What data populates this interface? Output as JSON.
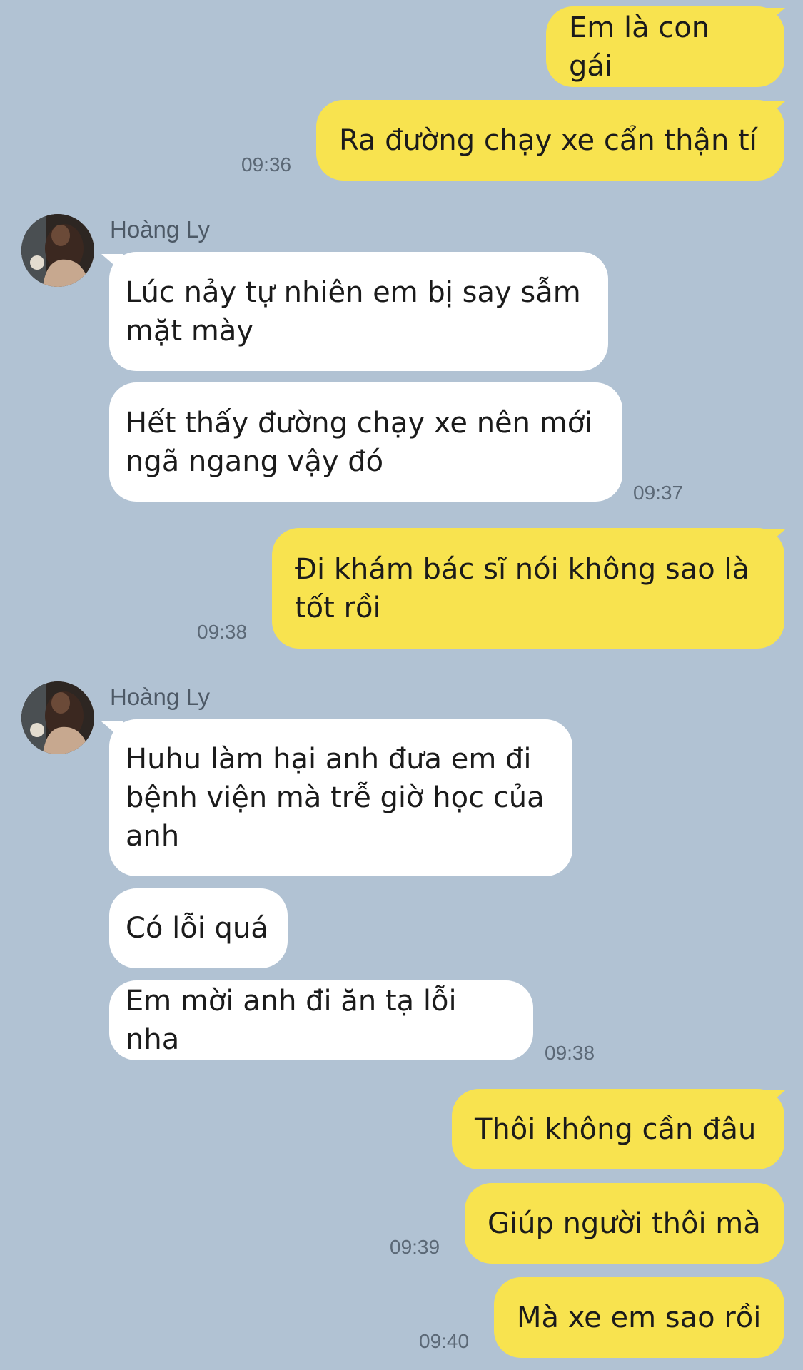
{
  "contact": {
    "name": "Hoàng Ly"
  },
  "colors": {
    "background": "#b1c2d3",
    "outgoing_bubble": "#f8e34f",
    "incoming_bubble": "#ffffff",
    "timestamp": "#5b6876"
  },
  "messages": [
    {
      "from": "me",
      "text": "Em là con gái",
      "time": ""
    },
    {
      "from": "me",
      "text": "Ra đường chạy xe cẩn thận tí",
      "time": "09:36"
    },
    {
      "from": "them",
      "text": "Lúc nảy tự nhiên em bị say sẫm\nmặt mày",
      "time": ""
    },
    {
      "from": "them",
      "text": "Hết thấy đường chạy xe nên mới\nngã ngang vậy đó",
      "time": "09:37"
    },
    {
      "from": "me",
      "text": "Đi khám bác sĩ nói không sao là\ntốt rồi",
      "time": "09:38"
    },
    {
      "from": "them",
      "text": "Huhu làm hại anh đưa em đi\nbệnh viện mà trễ giờ học của\nanh",
      "time": ""
    },
    {
      "from": "them",
      "text": "Có lỗi quá",
      "time": ""
    },
    {
      "from": "them",
      "text": "Em mời anh đi ăn tạ lỗi nha",
      "time": "09:38"
    },
    {
      "from": "me",
      "text": "Thôi không cần đâu",
      "time": ""
    },
    {
      "from": "me",
      "text": "Giúp người thôi mà",
      "time": "09:39"
    },
    {
      "from": "me",
      "text": "Mà xe em sao rồi",
      "time": "09:40"
    }
  ]
}
